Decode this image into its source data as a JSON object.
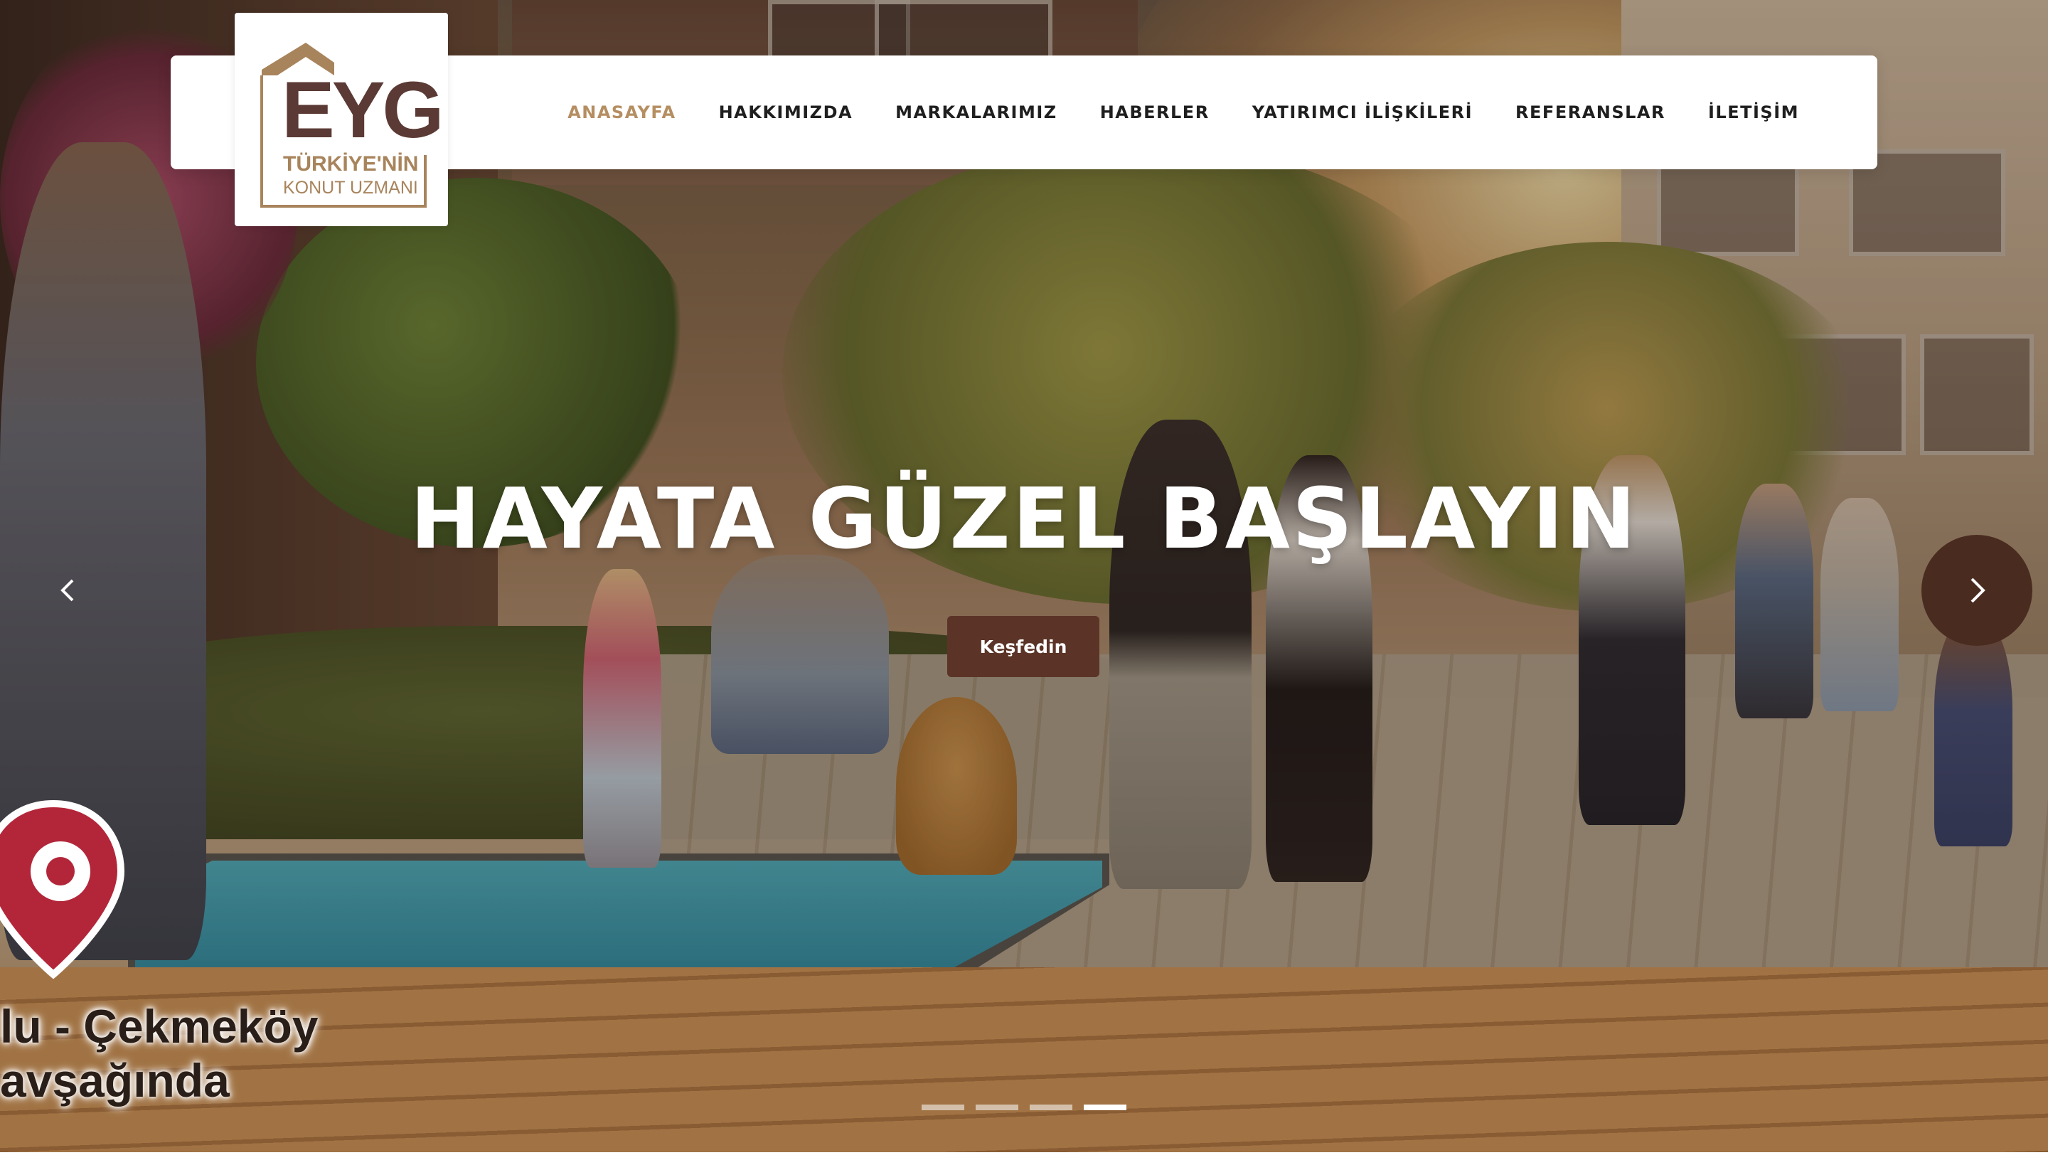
{
  "logo": {
    "mark": "EYG",
    "tagline_line1": "TÜRKİYE'NİN",
    "tagline_line2": "KONUT UZMANI",
    "brand_color": "#5b3a35",
    "accent_color": "#a8845c"
  },
  "nav": {
    "items": [
      {
        "label": "ANASAYFA",
        "active": true
      },
      {
        "label": "HAKKIMIZDA",
        "active": false
      },
      {
        "label": "MARKALARIMIZ",
        "active": false
      },
      {
        "label": "HABERLER",
        "active": false
      },
      {
        "label": "YATIRIMCI İLİŞKİLERİ",
        "active": false
      },
      {
        "label": "REFERANSLAR",
        "active": false
      },
      {
        "label": "İLETİŞİM",
        "active": false
      }
    ],
    "active_color": "#b58e61"
  },
  "hero": {
    "headline": "HAYATA GÜZEL BAŞLAYIN",
    "cta_label": "Keşfedin",
    "cta_color": "#5b3427",
    "location_text_line1": "lu - Çekmeköy",
    "location_text_line2": "avşağında",
    "prev_icon": "chevron-left-icon",
    "next_icon": "chevron-right-icon"
  },
  "slider": {
    "slide_count": 4,
    "active_slide": 4
  }
}
